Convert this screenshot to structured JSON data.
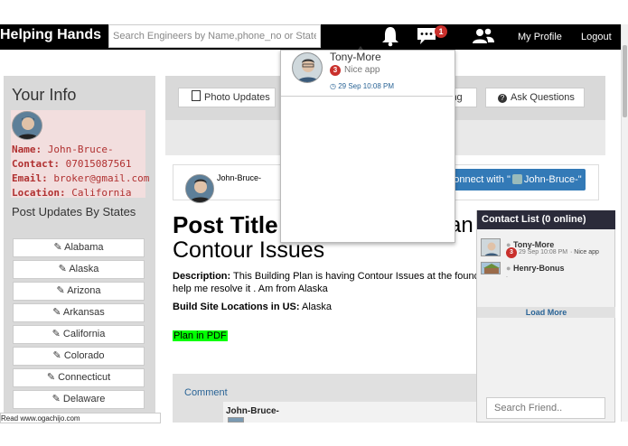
{
  "navbar": {
    "brand": "Helping Hands",
    "search_placeholder": "Search Engineers by Name,phone_no or States",
    "msg_badge": "1",
    "my_profile": "My Profile",
    "logout": "Logout"
  },
  "notifications": [
    {
      "name": "Tony-More",
      "badge": "3",
      "text": "Nice app",
      "time": "29 Sep 10:08 PM"
    }
  ],
  "left": {
    "your_info": "Your Info",
    "name_label": "Name:",
    "name": "John-Bruce-",
    "contact_label": "Contact:",
    "contact": "07015087561",
    "email_label": "Email:",
    "email": "broker@gmail.com",
    "location_label": "Location:",
    "location": "California",
    "post_updates_title": "Post Updates By States",
    "states": [
      "Alabama",
      "Alaska",
      "Arizona",
      "Arkansas",
      "California",
      "Colorado",
      "Connecticut",
      "Delaware"
    ]
  },
  "toolbar": {
    "photo_updates": "Photo Updates",
    "ing_fragment": "ing",
    "ask_questions": "Ask Questions"
  },
  "post": {
    "author": "John-Bruce-",
    "connect_prefix": "Connect with \"",
    "connect_name": "John-Bruce-\"",
    "title_start": "Post Title",
    "title_end": "an",
    "title_line2": "Contour Issues",
    "desc_label": "Description:",
    "desc_text": "This Building Plan is having Contour Issues at the foundat help me resolve it . Am from Alaska",
    "bsl_label": "Build Site Locations in US:",
    "bsl_value": "Alaska",
    "plan_link": "Plan in PDF",
    "comment_label": "Comment",
    "comment_author": "John-Bruce-"
  },
  "contacts": {
    "header": "Contact List (0 online)",
    "items": [
      {
        "name": "Tony-More",
        "badge": "3",
        "time": "29 Sep 10:08 PM",
        "msg": "Nice app"
      },
      {
        "name": "Henry-Bonus",
        "badge": "",
        "time": "",
        "msg": "."
      }
    ],
    "load_more": "Load More",
    "search_placeholder": "Search Friend.."
  },
  "status_url": "Read www.ogachijo.com",
  "colors": {
    "navbar": "#000000",
    "accent": "#337ab7",
    "badge": "#c9302c",
    "pdf_highlight": "#00ff00"
  }
}
